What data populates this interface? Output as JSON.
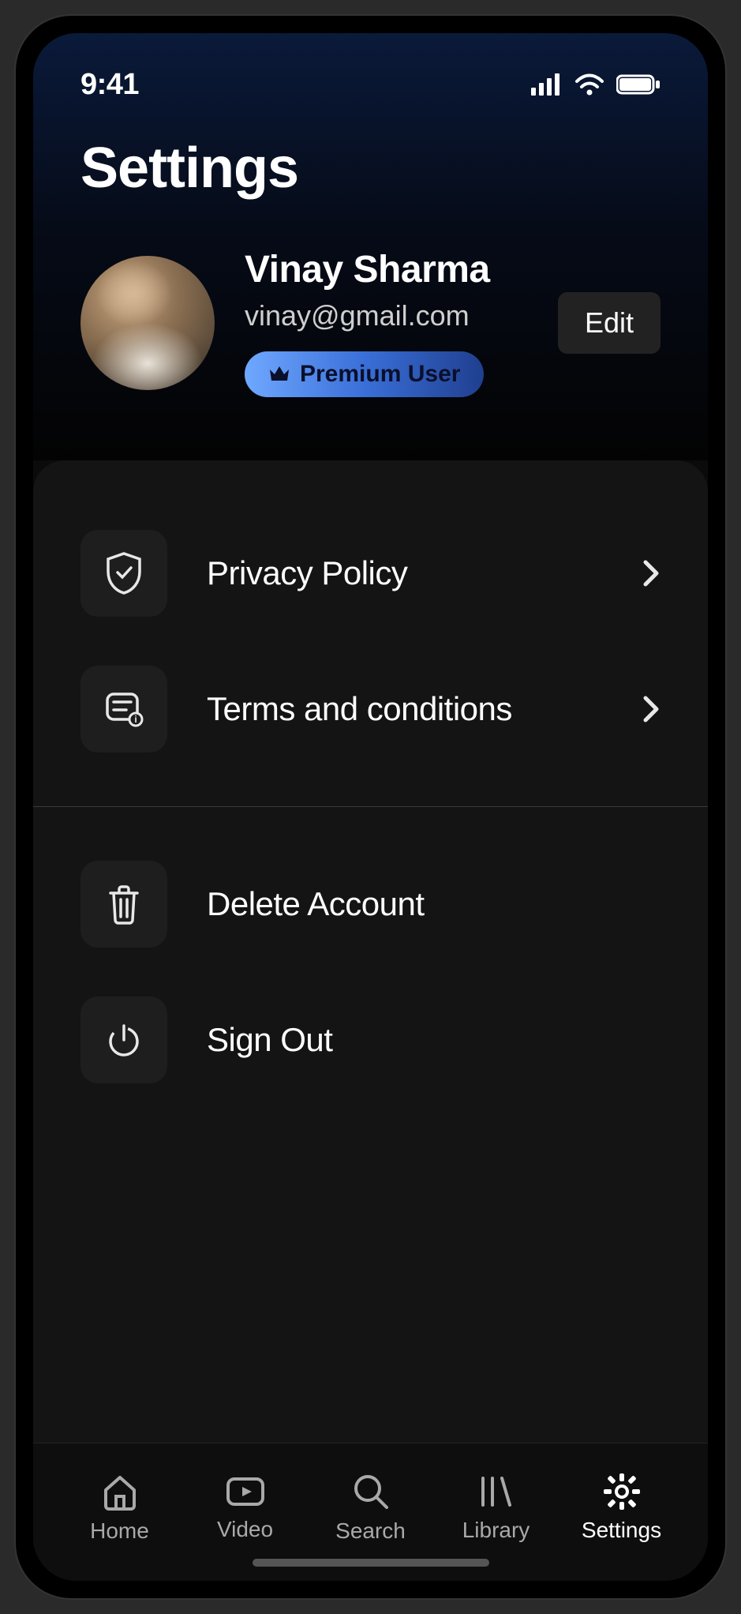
{
  "status": {
    "time": "9:41"
  },
  "header": {
    "title": "Settings"
  },
  "profile": {
    "name": "Vinay Sharma",
    "email": "vinay@gmail.com",
    "badge_label": "Premium User",
    "edit_label": "Edit"
  },
  "list": {
    "privacy_label": "Privacy Policy",
    "terms_label": "Terms and conditions",
    "delete_label": "Delete Account",
    "signout_label": "Sign Out"
  },
  "nav": {
    "home": "Home",
    "video": "Video",
    "search": "Search",
    "library": "Library",
    "settings": "Settings"
  }
}
